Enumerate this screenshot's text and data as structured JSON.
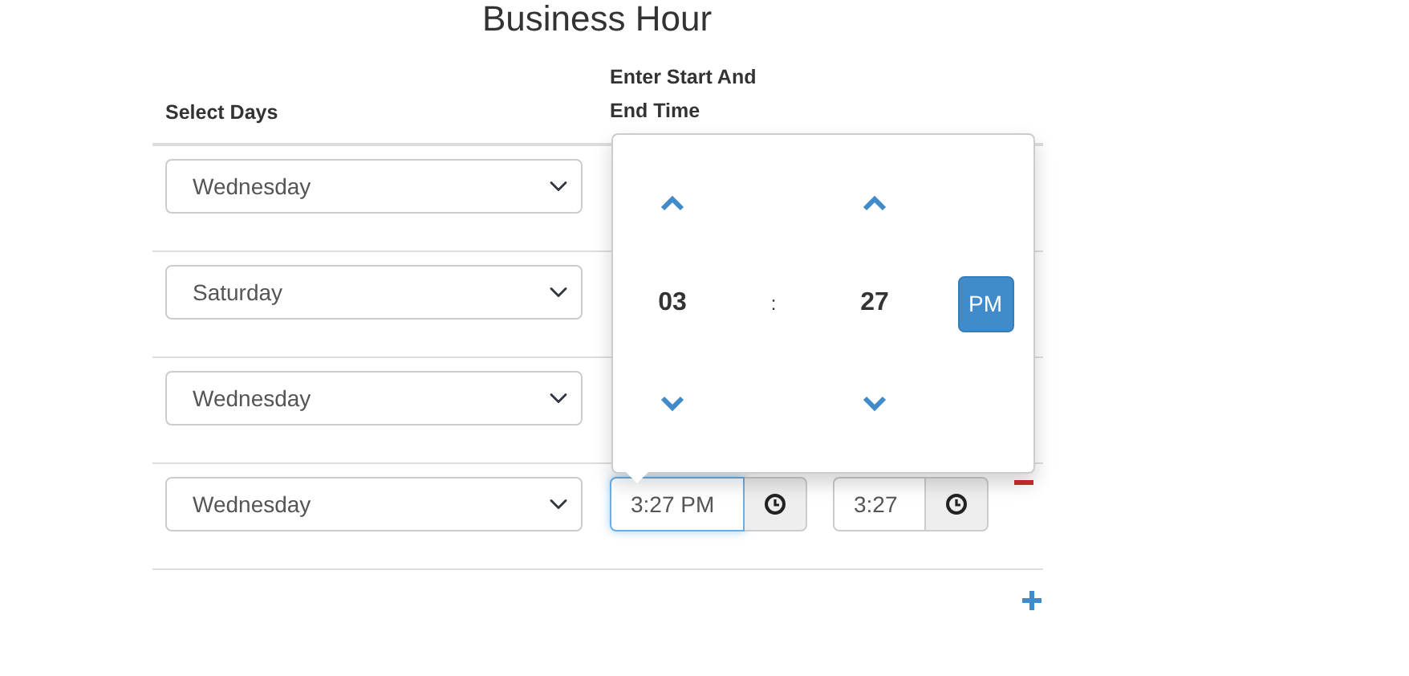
{
  "title": "Business Hour",
  "columns": [
    "Select Days",
    "Enter Start And End Time"
  ],
  "rows": [
    {
      "day": "Wednesday"
    },
    {
      "day": "Saturday"
    },
    {
      "day": "Wednesday"
    },
    {
      "day": "Wednesday",
      "start_time": "3:27 PM",
      "start_focused": true,
      "end_time": "3:27",
      "removable": true
    }
  ],
  "add_button": true,
  "time_picker": {
    "hour": "03",
    "separator": ":",
    "minute": "27",
    "meridian": "PM"
  }
}
